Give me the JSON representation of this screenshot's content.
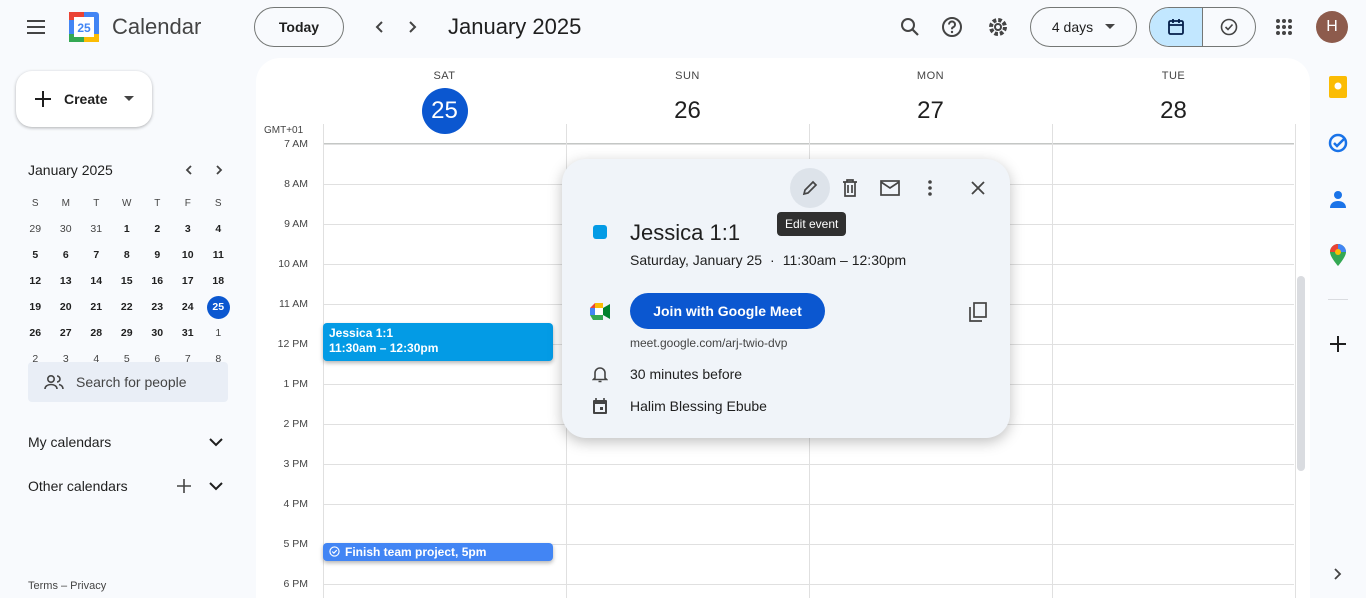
{
  "header": {
    "app_name": "Calendar",
    "logo_day": "25",
    "today_label": "Today",
    "period_title": "January 2025",
    "view_label": "4 days",
    "avatar_initial": "H",
    "accent": "#0b57d0"
  },
  "sidebar": {
    "create_label": "Create",
    "mini_title": "January 2025",
    "weekday_headers": [
      "S",
      "M",
      "T",
      "W",
      "T",
      "F",
      "S"
    ],
    "weeks": [
      [
        "29",
        "30",
        "31",
        "1",
        "2",
        "3",
        "4"
      ],
      [
        "5",
        "6",
        "7",
        "8",
        "9",
        "10",
        "11"
      ],
      [
        "12",
        "13",
        "14",
        "15",
        "16",
        "17",
        "18"
      ],
      [
        "19",
        "20",
        "21",
        "22",
        "23",
        "24",
        "25"
      ],
      [
        "26",
        "27",
        "28",
        "29",
        "30",
        "31",
        "1"
      ],
      [
        "2",
        "3",
        "4",
        "5",
        "6",
        "7",
        "8"
      ]
    ],
    "today": "25",
    "search_people_placeholder": "Search for people",
    "my_calendars": "My calendars",
    "other_calendars": "Other calendars",
    "footer": "Terms – Privacy"
  },
  "grid": {
    "timezone": "GMT+01",
    "days": [
      {
        "dow": "SAT",
        "num": "25",
        "today": true
      },
      {
        "dow": "SUN",
        "num": "26"
      },
      {
        "dow": "MON",
        "num": "27"
      },
      {
        "dow": "TUE",
        "num": "28"
      }
    ],
    "hours": [
      "7 AM",
      "8 AM",
      "9 AM",
      "10 AM",
      "11 AM",
      "12 PM",
      "1 PM",
      "2 PM",
      "3 PM",
      "4 PM",
      "5 PM",
      "6 PM"
    ],
    "events": [
      {
        "title": "Jessica 1:1",
        "time": "11:30am – 12:30pm",
        "color": "#039be5"
      },
      {
        "title": "Finish team project, 5pm",
        "color": "#4285f4"
      }
    ]
  },
  "popup": {
    "title": "Jessica 1:1",
    "date": "Saturday, January 25",
    "time": "11:30am – 12:30pm",
    "color": "#039be5",
    "join_label": "Join with Google Meet",
    "meet_link": "meet.google.com/arj-twio-dvp",
    "reminder": "30 minutes before",
    "calendar_owner": "Halim Blessing Ebube",
    "tooltip": "Edit event"
  }
}
